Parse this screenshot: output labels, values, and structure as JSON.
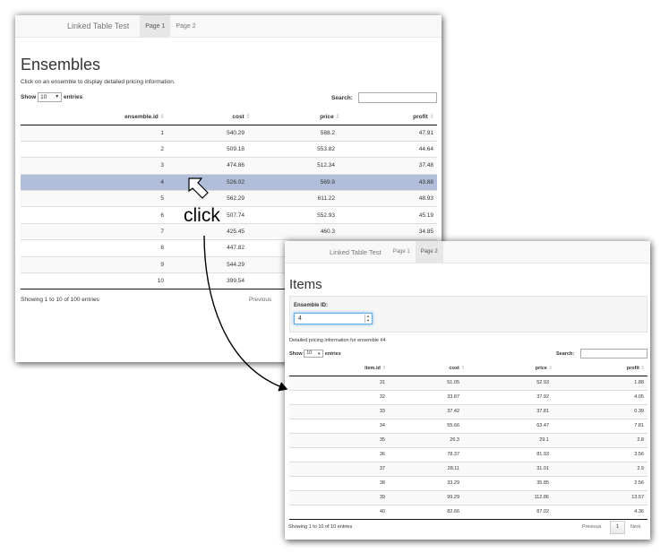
{
  "page1": {
    "brand": "Linked Table Test",
    "tabs": [
      "Page 1",
      "Page 2"
    ],
    "title": "Ensembles",
    "subtitle": "Click on an ensemble to display detailed pricing information.",
    "show_label": "Show",
    "entries_label": "entries",
    "length_value": "10",
    "search_label": "Search:",
    "columns": [
      "ensemble.id",
      "cost",
      "price",
      "profit"
    ],
    "rows": [
      [
        "1",
        "540.29",
        "588.2",
        "47.91"
      ],
      [
        "2",
        "509.18",
        "553.82",
        "44.64"
      ],
      [
        "3",
        "474.86",
        "512.34",
        "37.48"
      ],
      [
        "4",
        "526.02",
        "569.9",
        "43.88"
      ],
      [
        "5",
        "562.29",
        "611.22",
        "48.93"
      ],
      [
        "6",
        "507.74",
        "552.93",
        "45.19"
      ],
      [
        "7",
        "425.45",
        "460.3",
        "34.85"
      ],
      [
        "8",
        "447.82",
        "",
        ""
      ],
      [
        "9",
        "544.29",
        "",
        ""
      ],
      [
        "10",
        "399.54",
        "",
        ""
      ]
    ],
    "selected_row": 3,
    "info": "Showing 1 to 10 of 100 entries",
    "previous_label": "Previous"
  },
  "annotation": {
    "click_label": "click"
  },
  "page2": {
    "brand": "Linked Table Test",
    "tabs": [
      "Page 1",
      "Page 2"
    ],
    "title": "Items",
    "input_label": "Ensemble ID:",
    "input_value": "4",
    "subtitle": "Detailed pricing information for ensemble #4",
    "show_label": "Show",
    "entries_label": "entries",
    "length_value": "10",
    "search_label": "Search:",
    "columns": [
      "item.id",
      "cost",
      "price",
      "profit"
    ],
    "rows": [
      [
        "31",
        "51.05",
        "52.93",
        "1.88"
      ],
      [
        "32",
        "33.87",
        "37.92",
        "4.05"
      ],
      [
        "33",
        "37.42",
        "37.81",
        "0.39"
      ],
      [
        "34",
        "55.66",
        "63.47",
        "7.81"
      ],
      [
        "35",
        "26.3",
        "29.1",
        "2.8"
      ],
      [
        "36",
        "78.37",
        "81.93",
        "3.56"
      ],
      [
        "37",
        "28.11",
        "31.01",
        "2.9"
      ],
      [
        "38",
        "33.29",
        "35.85",
        "2.56"
      ],
      [
        "39",
        "99.29",
        "112.86",
        "13.57"
      ],
      [
        "40",
        "82.66",
        "87.02",
        "4.36"
      ]
    ],
    "info": "Showing 1 to 10 of 10 entries",
    "previous_label": "Previous",
    "page_number": "1",
    "next_label": "Next"
  }
}
